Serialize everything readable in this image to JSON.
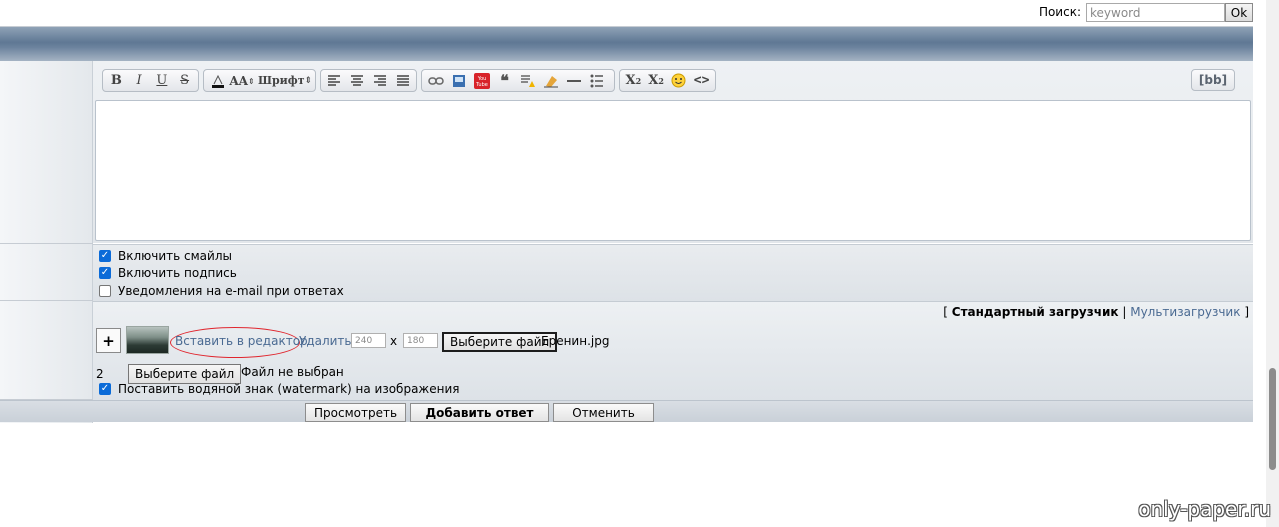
{
  "search": {
    "label": "Поиск:",
    "placeholder": "keyword",
    "ok_label": "Ok"
  },
  "toolbar": {
    "bold": "B",
    "italic": "I",
    "underline": "U",
    "strike": "S",
    "font_size": "AA",
    "font_label": "Шрифт",
    "bb_label": "[bb]",
    "icons": [
      "bold-icon",
      "italic-icon",
      "underline-icon",
      "strike-icon",
      "text-color-icon",
      "font-size-icon",
      "font-family-select",
      "align-left-icon",
      "align-center-icon",
      "align-right-icon",
      "justify-icon",
      "link-icon",
      "image-icon",
      "youtube-icon",
      "quote-icon",
      "spoiler-icon",
      "clear-format-icon",
      "hr-icon",
      "list-icon",
      "superscript-icon",
      "subscript-icon",
      "smiley-icon",
      "code-icon"
    ]
  },
  "options": {
    "items": [
      {
        "label": "Включить смайлы",
        "checked": true
      },
      {
        "label": "Включить подпись",
        "checked": true
      },
      {
        "label": "Уведомления на e-mail при ответах",
        "checked": false
      }
    ]
  },
  "upload": {
    "bracket_open": "[",
    "standard": "Стандартный загрузчик",
    "separator": "|",
    "multi": "Мультизагрузчик",
    "bracket_close": "]",
    "plus": "+",
    "insert_link": "Вставить в редактор",
    "delete_link": "Удалить",
    "width": "240",
    "x": "x",
    "height": "180",
    "choose_file": "Выберите файл",
    "file_name": "Еренин.jpg",
    "row_number": "2",
    "choose_file2": "Выберите файл",
    "no_file": "Файл не выбран",
    "watermark_label": "Поставить водяной знак (watermark) на изображения",
    "watermark_checked": true
  },
  "actions": {
    "preview": "Просмотреть",
    "submit": "Добавить ответ",
    "cancel": "Отменить"
  },
  "site_watermark": "only-paper.ru",
  "colors": {
    "link": "#4a6a92",
    "highlight_circle": "#e0262e",
    "checkbox": "#0b6bd8"
  }
}
